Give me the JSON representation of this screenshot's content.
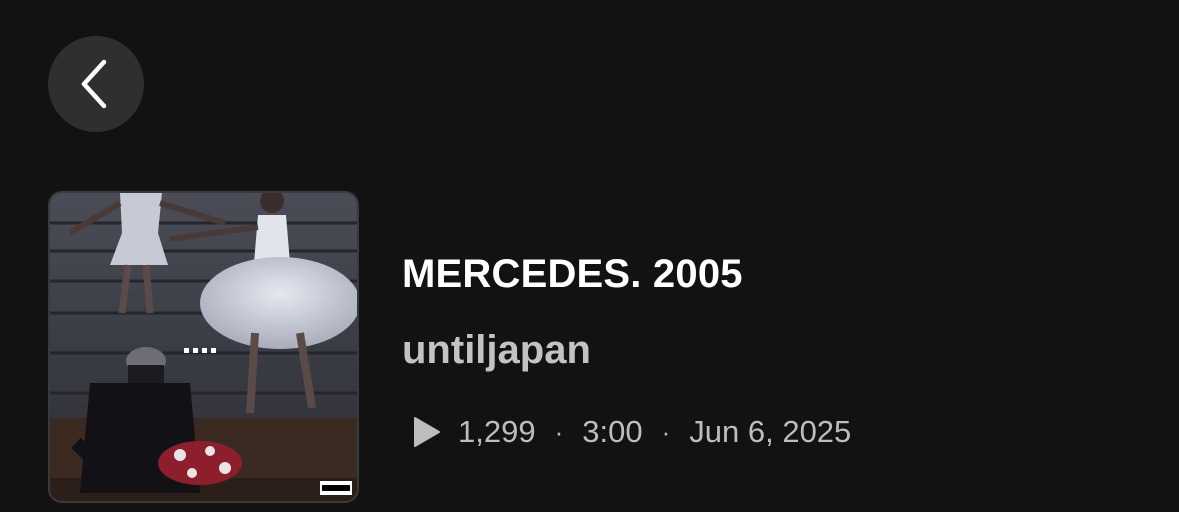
{
  "header": {
    "back_icon": "chevron-left-icon"
  },
  "track": {
    "title": "MERCEDES. 2005",
    "artist": "untiljapan",
    "plays": "1,299",
    "duration": "3:00",
    "release_date": "Jun 6, 2025",
    "separator": "·",
    "play_icon": "play-icon"
  },
  "cover": {
    "advisory_label": "PARENTAL ADVISORY EXPLICIT CONTENT",
    "pause_indicator": "...."
  },
  "colors": {
    "background": "#121212",
    "back_button_bg": "#2f2f2f",
    "title": "#ffffff",
    "artist": "#c3c3c3",
    "meta": "#bdbdbd"
  }
}
